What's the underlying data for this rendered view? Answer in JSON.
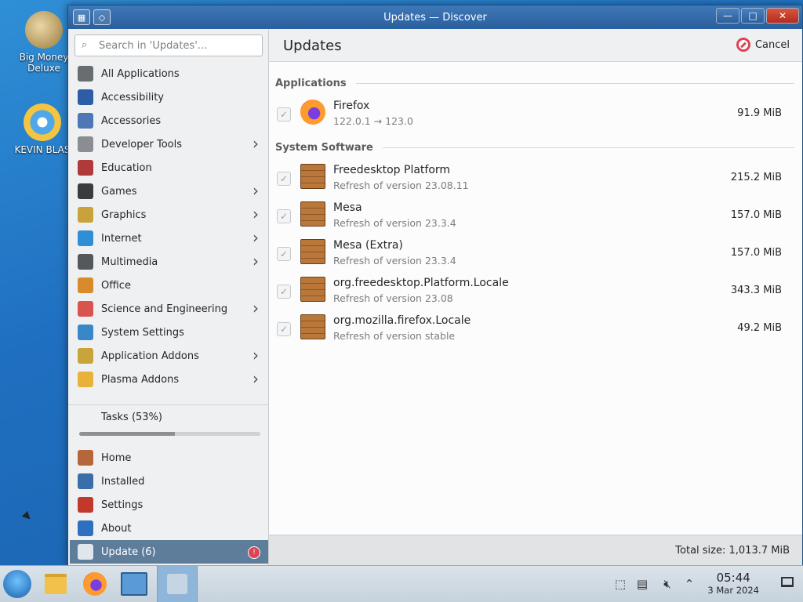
{
  "desktop": {
    "icons": [
      {
        "label": "Big Money\nDeluxe",
        "icon": "money-bag-icon"
      },
      {
        "label": "KEVIN BLAS",
        "icon": "sun-globe-icon"
      }
    ]
  },
  "window": {
    "title": "Updates — Discover"
  },
  "sidebar": {
    "search_placeholder": "Search in 'Updates'...",
    "categories": [
      {
        "label": "All Applications",
        "icon": "all-apps-icon",
        "color": "#6a6d70",
        "has_submenu": false
      },
      {
        "label": "Accessibility",
        "icon": "accessibility-icon",
        "color": "#2e5da8",
        "has_submenu": false
      },
      {
        "label": "Accessories",
        "icon": "accessories-icon",
        "color": "#4d78b5",
        "has_submenu": false
      },
      {
        "label": "Developer Tools",
        "icon": "developer-tools-icon",
        "color": "#8a8d91",
        "has_submenu": true
      },
      {
        "label": "Education",
        "icon": "education-icon",
        "color": "#b03a3a",
        "has_submenu": false
      },
      {
        "label": "Games",
        "icon": "games-icon",
        "color": "#3a3d40",
        "has_submenu": true
      },
      {
        "label": "Graphics",
        "icon": "graphics-icon",
        "color": "#c9a23a",
        "has_submenu": true
      },
      {
        "label": "Internet",
        "icon": "internet-icon",
        "color": "#2f8fd6",
        "has_submenu": true
      },
      {
        "label": "Multimedia",
        "icon": "multimedia-icon",
        "color": "#55585b",
        "has_submenu": true
      },
      {
        "label": "Office",
        "icon": "office-icon",
        "color": "#d98b2b",
        "has_submenu": false
      },
      {
        "label": "Science and Engineering",
        "icon": "science-icon",
        "color": "#d9534f",
        "has_submenu": true
      },
      {
        "label": "System Settings",
        "icon": "system-settings-icon",
        "color": "#3a87c8",
        "has_submenu": false
      },
      {
        "label": "Application Addons",
        "icon": "application-addons-icon",
        "color": "#c8a43a",
        "has_submenu": true
      },
      {
        "label": "Plasma Addons",
        "icon": "plasma-addons-icon",
        "color": "#e8b23a",
        "has_submenu": true
      }
    ],
    "tasks_label": "Tasks (53%)",
    "tasks_progress": 0.53,
    "bottom_items": [
      {
        "label": "Home",
        "icon": "home-icon",
        "color": "#b5663a"
      },
      {
        "label": "Installed",
        "icon": "installed-icon",
        "color": "#3a6ea8"
      },
      {
        "label": "Settings",
        "icon": "settings-icon",
        "color": "#c0392b"
      },
      {
        "label": "About",
        "icon": "about-icon",
        "color": "#2e6fc0"
      }
    ],
    "update_item": {
      "label": "Update (6)",
      "badge": "!"
    }
  },
  "main": {
    "title": "Updates",
    "cancel_label": "Cancel",
    "sections": [
      {
        "title": "Applications",
        "items": [
          {
            "name": "Firefox",
            "desc": "122.0.1 → 123.0",
            "size": "91.9 MiB",
            "icon": "firefox-icon",
            "checked": true
          }
        ]
      },
      {
        "title": "System Software",
        "items": [
          {
            "name": "Freedesktop Platform",
            "desc": "Refresh of version 23.08.11",
            "size": "215.2 MiB",
            "icon": "package-box-icon",
            "checked": true
          },
          {
            "name": "Mesa",
            "desc": "Refresh of version 23.3.4",
            "size": "157.0 MiB",
            "icon": "package-box-icon",
            "checked": true
          },
          {
            "name": "Mesa (Extra)",
            "desc": "Refresh of version 23.3.4",
            "size": "157.0 MiB",
            "icon": "package-box-icon",
            "checked": true
          },
          {
            "name": "org.freedesktop.Platform.Locale",
            "desc": "Refresh of version 23.08",
            "size": "343.3 MiB",
            "icon": "package-box-icon",
            "checked": true
          },
          {
            "name": "org.mozilla.firefox.Locale",
            "desc": "Refresh of version stable",
            "size": "49.2 MiB",
            "icon": "package-box-icon",
            "checked": true
          }
        ]
      }
    ],
    "total_size": "Total size: 1,013.7 MiB"
  },
  "taskbar": {
    "time": "05:44",
    "date": "3 Mar 2024"
  }
}
